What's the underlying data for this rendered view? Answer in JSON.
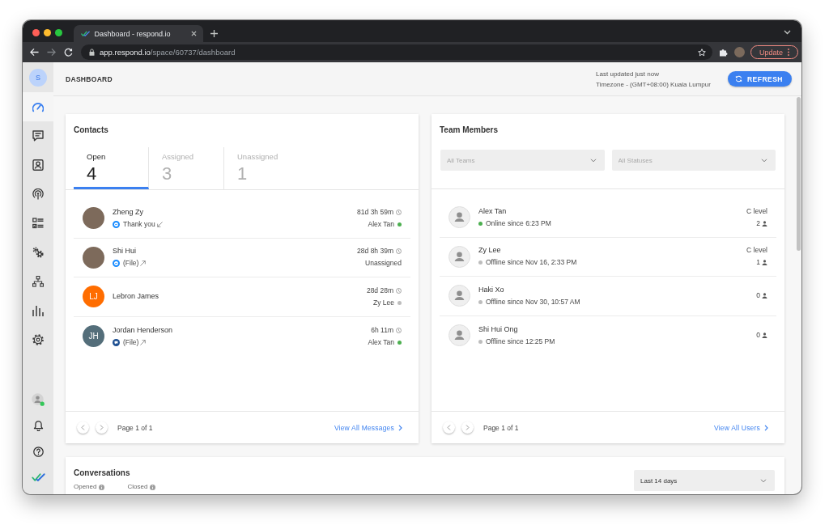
{
  "browser": {
    "tab_title": "Dashboard - respond.io",
    "url": {
      "host": "app.respond.io",
      "path": "/space/60737/dashboard"
    },
    "update_button": "Update"
  },
  "sidebar": {
    "workspace_initial": "S",
    "items": [
      {
        "kind": "gauge",
        "selected": true
      },
      {
        "kind": "chat",
        "selected": false
      },
      {
        "kind": "contact",
        "selected": false
      },
      {
        "kind": "broadcast",
        "selected": false
      },
      {
        "kind": "checklist",
        "selected": false
      },
      {
        "kind": "gears",
        "selected": false
      },
      {
        "kind": "hierarchy",
        "selected": false
      },
      {
        "kind": "bars",
        "selected": false
      },
      {
        "kind": "gear",
        "selected": false
      }
    ],
    "profile": {
      "online": true
    },
    "utility_items": [
      {
        "kind": "bell"
      },
      {
        "kind": "help"
      },
      {
        "kind": "logo"
      }
    ]
  },
  "header": {
    "title": "DASHBOARD",
    "last_updated": "Last updated just now",
    "timezone": "Timezone - (GMT+08:00) Kuala Lumpur",
    "refresh_button": "REFRESH"
  },
  "contacts": {
    "title": "Contacts",
    "tabs": [
      {
        "label": "Open",
        "count": "4",
        "selected": true
      },
      {
        "label": "Assigned",
        "count": "3",
        "selected": false
      },
      {
        "label": "Unassigned",
        "count": "1",
        "selected": false
      }
    ],
    "rows": [
      {
        "name": "Zheng Zy",
        "avatar": {
          "kind": "photo"
        },
        "message": {
          "channel": {
            "kind": "messenger"
          },
          "text": "Thank you",
          "incoming": true
        },
        "time": "81d 3h 59m",
        "agent": {
          "name": "Alex Tan",
          "color": "#4caf50"
        }
      },
      {
        "name": "Shi Hui",
        "avatar": {
          "kind": "photo"
        },
        "message": {
          "channel": {
            "kind": "messenger"
          },
          "text": "(File)",
          "incoming": false
        },
        "time": "28d 8h 39m",
        "agent": {
          "name": "Unassigned"
        }
      },
      {
        "name": "Lebron James",
        "avatar": {
          "kind": "initials",
          "initials": "LJ",
          "color": "#ff6d00"
        },
        "time": "28d 28m",
        "agent": {
          "name": "Zy Lee",
          "color": "#bdbdbd"
        }
      },
      {
        "name": "Jordan Henderson",
        "avatar": {
          "kind": "initials",
          "initials": "JH",
          "color": "#546e7a"
        },
        "message": {
          "channel": {
            "kind": "chat"
          },
          "text": "(File)",
          "incoming": false
        },
        "time": "6h 11m",
        "agent": {
          "name": "Alex Tan",
          "color": "#4caf50"
        }
      }
    ],
    "pager": "Page 1 of 1",
    "view_all": "View All Messages"
  },
  "team_members": {
    "title": "Team Members",
    "filters": [
      {
        "placeholder": "All Teams"
      },
      {
        "placeholder": "All Statuses"
      }
    ],
    "rows": [
      {
        "name": "Alex Tan",
        "status": "Online since 6:23 PM",
        "color": "#4caf50",
        "role": "C level",
        "count": "2"
      },
      {
        "name": "Zy Lee",
        "status": "Offline since Nov 16, 2:33 PM",
        "color": "#bdbdbd",
        "role": "C level",
        "count": "1"
      },
      {
        "name": "Haki Xo",
        "status": "Offline since Nov 30, 10:57 AM",
        "color": "#bdbdbd",
        "count": "0"
      },
      {
        "name": "Shi Hui Ong",
        "status": "Offline since 12:25 PM",
        "color": "#bdbdbd",
        "count": "0"
      }
    ],
    "pager": "Page 1 of 1",
    "view_all": "View All Users"
  },
  "conversations": {
    "title": "Conversations",
    "date_range": "Last 14 days",
    "stats": [
      {
        "label": "Opened"
      },
      {
        "label": "Closed"
      }
    ]
  }
}
